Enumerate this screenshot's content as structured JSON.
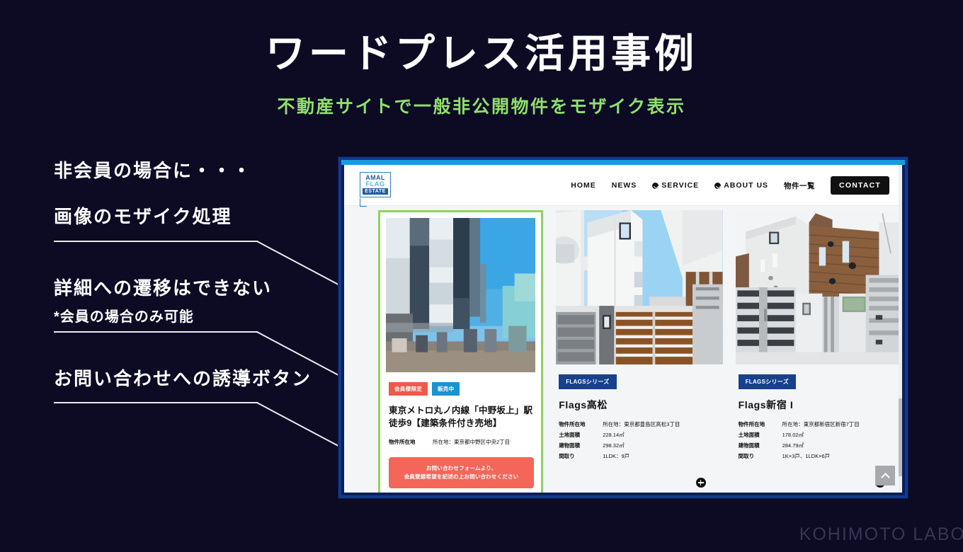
{
  "slide": {
    "title": "ワードプレス活用事例",
    "subtitle": "不動産サイトで一般非公開物件をモザイク表示",
    "title_color": "#ffffff",
    "subtitle_color": "#8ee06a",
    "background_color": "#0d0a24",
    "watermark": "KOHIMOTO LABO"
  },
  "annotations": [
    {
      "heading": "非会員の場合に・・・",
      "sub": ""
    },
    {
      "heading": "画像のモザイク処理",
      "sub": ""
    },
    {
      "heading": "詳細への遷移はできない",
      "sub": "*会員の場合のみ可能"
    },
    {
      "heading": "お問い合わせへの誘導ボタン",
      "sub": ""
    }
  ],
  "site": {
    "logo": {
      "line1": "AMAL",
      "line2": "FLAG",
      "line3": "ESTATE",
      "color": "#1f5c9e"
    },
    "nav": [
      {
        "label": "HOME",
        "has_caret": false
      },
      {
        "label": "NEWS",
        "has_caret": false
      },
      {
        "label": "SERVICE",
        "has_caret": true
      },
      {
        "label": "ABOUT US",
        "has_caret": true
      },
      {
        "label": "物件一覧",
        "has_caret": false
      }
    ],
    "cta_label": "CONTACT",
    "scroll_top_label": "",
    "highlight_color": "#8ed45c",
    "frame_color": "#123a8c",
    "frame_accent": "#1a9ae0"
  },
  "cards": [
    {
      "id": "card-mosaic",
      "image": "mosaic-cityscape",
      "badges": [
        {
          "text": "会員様限定",
          "color": "#f0594a"
        },
        {
          "text": "販売中",
          "color": "#1b92d1"
        }
      ],
      "title": "東京メトロ丸ノ内線「中野坂上」駅徒歩9【建築条件付き売地】",
      "specs": [
        {
          "key": "物件所在地",
          "value": "所在地：東京都中野区中央2丁目"
        }
      ],
      "cta": "お問い合わせフォームより、\n会員登録希望を記述の上お問い合わせください",
      "cta_line1": "お問い合わせフォームより、",
      "cta_line2": "会員登録希望を記述の上お問い合わせください",
      "cta_color": "#f4655a",
      "has_plus": false
    },
    {
      "id": "card-flags-takamatsu",
      "image": "white-apartment-photo",
      "badges": [
        {
          "text": "FLAGSシリーズ",
          "color": "#17418b"
        }
      ],
      "title": "Flags高松",
      "specs": [
        {
          "key": "物件所在地",
          "value": "所在地：東京都豊島区高松3丁目"
        },
        {
          "key": "土地面積",
          "value": "228.14㎡"
        },
        {
          "key": "建物面積",
          "value": "298.32㎡"
        },
        {
          "key": "間取り",
          "value": "1LDK：9戸"
        }
      ],
      "has_plus": true
    },
    {
      "id": "card-flags-shinjuku",
      "image": "wood-facade-photo",
      "badges": [
        {
          "text": "FLAGSシリーズ",
          "color": "#17418b"
        }
      ],
      "title": "Flags新宿 I",
      "specs": [
        {
          "key": "物件所在地",
          "value": "所在地：東京都新宿区新宿7丁目"
        },
        {
          "key": "土地面積",
          "value": "178.02㎡"
        },
        {
          "key": "建物面積",
          "value": "284.79㎡"
        },
        {
          "key": "間取り",
          "value": "1K×3戸、1LDK×6戸"
        }
      ],
      "has_plus": true
    }
  ]
}
